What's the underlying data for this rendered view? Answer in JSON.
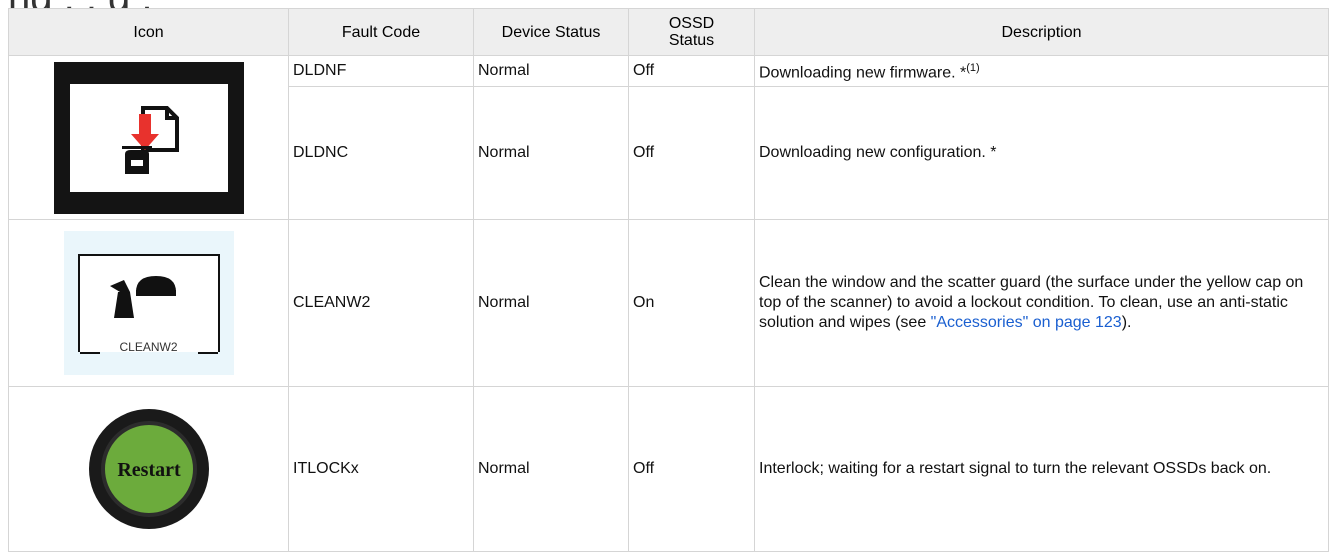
{
  "heading_partial": "ng                , ,            g ,",
  "table": {
    "headers": [
      "Icon",
      "Fault Code",
      "Device Status",
      "OSSD Status",
      "Description"
    ],
    "rows": [
      {
        "fault_code": "DLDNF",
        "device_status": "Normal",
        "ossd_status": "Off",
        "description": "Downloading new firmware. *",
        "description_sup": "(1)"
      },
      {
        "fault_code": "DLDNC",
        "device_status": "Normal",
        "ossd_status": "Off",
        "description": "Downloading new configuration. *"
      },
      {
        "fault_code": "CLEANW2",
        "device_status": "Normal",
        "ossd_status": "On",
        "description_pre": "Clean the window and the scatter guard (the surface under the yellow cap on top of the scanner) to avoid a lockout condition. To clean, use an anti-static solution and wipes (see ",
        "description_link": "\"Accessories\" on page 123",
        "description_post": ")."
      },
      {
        "fault_code": "ITLOCKx",
        "device_status": "Normal",
        "ossd_status": "Off",
        "description": "Interlock; waiting for a restart signal to turn the relevant OSSDs back on."
      }
    ]
  },
  "icons": {
    "download": "download-config-icon",
    "clean": "clean-window-icon",
    "clean_label": "CLEANW2",
    "restart": "restart-button-icon",
    "restart_label": "Restart"
  },
  "colors": {
    "header_bg": "#eeeeee",
    "link": "#1a5fd0",
    "restart_green": "#6cab3c",
    "arrow_red": "#e8322d"
  }
}
